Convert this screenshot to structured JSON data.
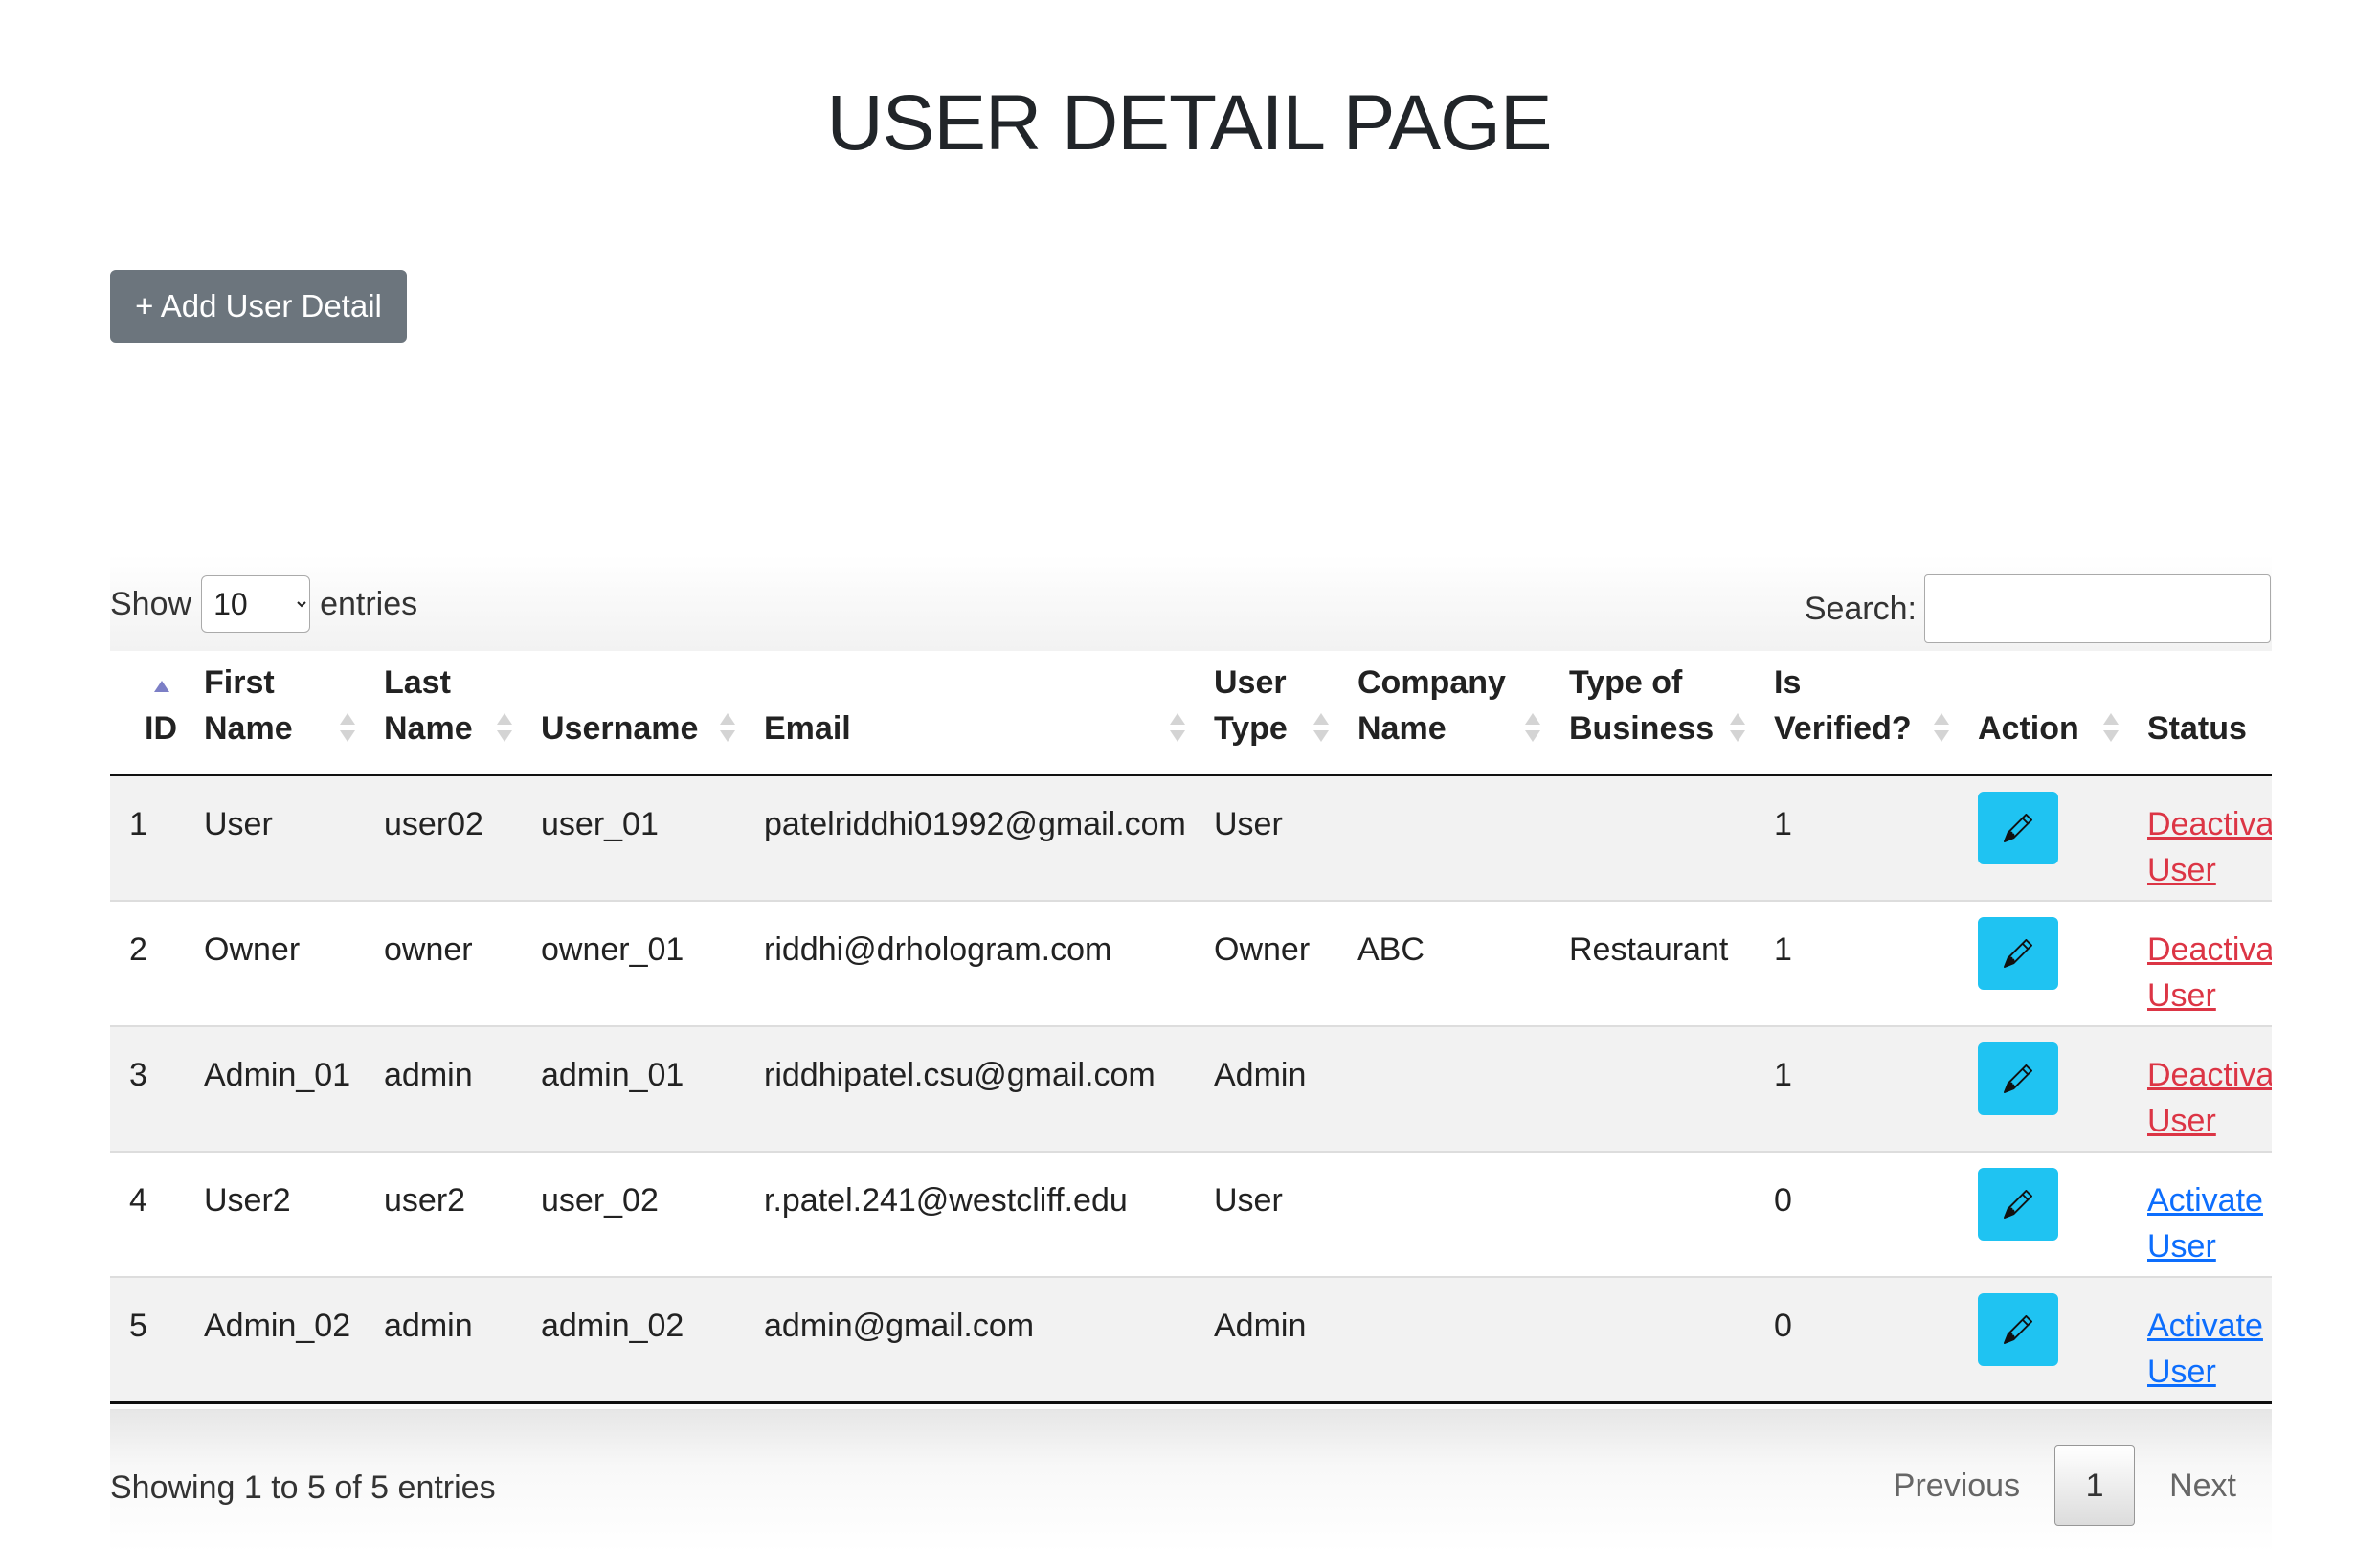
{
  "header": {
    "title": "USER DETAIL PAGE"
  },
  "toolbar": {
    "add_label": "+ Add User Detail"
  },
  "length_menu": {
    "prefix": "Show",
    "selected": "10",
    "suffix": "entries"
  },
  "search": {
    "label": "Search:",
    "value": ""
  },
  "table": {
    "columns": [
      {
        "key": "id",
        "label": "ID",
        "sort": "asc"
      },
      {
        "key": "first_name",
        "label": "First\nName",
        "sort": "both"
      },
      {
        "key": "last_name",
        "label": "Last\nName",
        "sort": "both"
      },
      {
        "key": "username",
        "label": "Username",
        "sort": "both"
      },
      {
        "key": "email",
        "label": "Email",
        "sort": "both"
      },
      {
        "key": "user_type",
        "label": "User\nType",
        "sort": "both"
      },
      {
        "key": "company",
        "label": "Company\nName",
        "sort": "both"
      },
      {
        "key": "business",
        "label": "Type of\nBusiness",
        "sort": "both"
      },
      {
        "key": "verified",
        "label": "Is\nVerified?",
        "sort": "both"
      },
      {
        "key": "action",
        "label": "Action",
        "sort": "both"
      },
      {
        "key": "status",
        "label": "Status",
        "sort": "both"
      }
    ],
    "rows": [
      {
        "id": "1",
        "first_name": "User",
        "last_name": "user02",
        "username": "user_01",
        "email": "patelriddhi01992@gmail.com",
        "user_type": "User",
        "company": "",
        "business": "",
        "verified": "1",
        "action_icon": "pencil-icon",
        "status_label": "Deactivate User",
        "status_kind": "deactivate"
      },
      {
        "id": "2",
        "first_name": "Owner",
        "last_name": "owner",
        "username": "owner_01",
        "email": "riddhi@drhologram.com",
        "user_type": "Owner",
        "company": "ABC",
        "business": "Restaurant",
        "verified": "1",
        "action_icon": "pencil-icon",
        "status_label": "Deactivate User",
        "status_kind": "deactivate"
      },
      {
        "id": "3",
        "first_name": "Admin_01",
        "last_name": "admin",
        "username": "admin_01",
        "email": "riddhipatel.csu@gmail.com",
        "user_type": "Admin",
        "company": "",
        "business": "",
        "verified": "1",
        "action_icon": "pencil-icon",
        "status_label": "Deactivate User",
        "status_kind": "deactivate"
      },
      {
        "id": "4",
        "first_name": "User2",
        "last_name": "user2",
        "username": "user_02",
        "email": "r.patel.241@westcliff.edu",
        "user_type": "User",
        "company": "",
        "business": "",
        "verified": "0",
        "action_icon": "pencil-icon",
        "status_label": "Activate User",
        "status_kind": "activate"
      },
      {
        "id": "5",
        "first_name": "Admin_02",
        "last_name": "admin",
        "username": "admin_02",
        "email": "admin@gmail.com",
        "user_type": "Admin",
        "company": "",
        "business": "",
        "verified": "0",
        "action_icon": "pencil-icon",
        "status_label": "Activate User",
        "status_kind": "activate"
      }
    ]
  },
  "footer": {
    "info": "Showing 1 to 5 of 5 entries",
    "previous": "Previous",
    "current_page": "1",
    "next": "Next"
  },
  "colors": {
    "add_button": "#6c757d",
    "edit_button": "#1fc3f2",
    "deactivate": "#dc3545",
    "activate": "#0d6efd",
    "stripe": "#f2f2f2"
  }
}
